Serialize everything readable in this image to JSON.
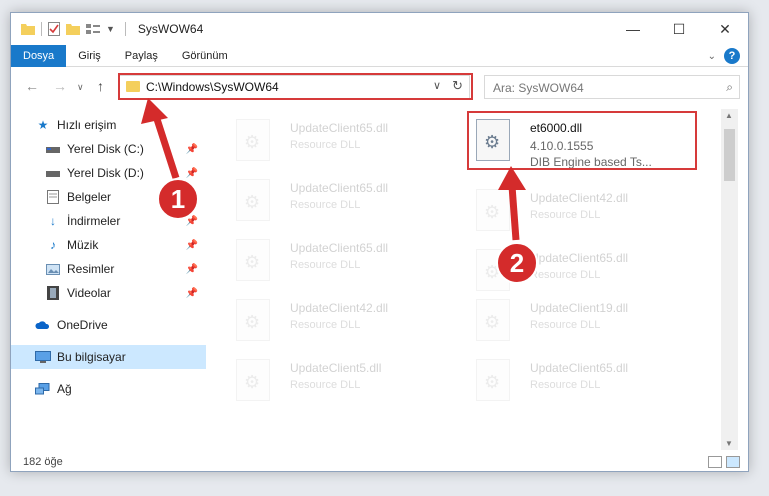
{
  "window": {
    "title": "SysWOW64"
  },
  "ribbon": {
    "tabs": [
      "Dosya",
      "Giriş",
      "Paylaş",
      "Görünüm"
    ]
  },
  "address": {
    "path": "C:\\Windows\\SysWOW64"
  },
  "search": {
    "placeholder": "Ara: SysWOW64"
  },
  "sidebar": {
    "items": [
      {
        "label": "Hızlı erişim",
        "icon": "star-icon"
      },
      {
        "label": "Yerel Disk (C:)",
        "icon": "drive-icon",
        "pinned": true
      },
      {
        "label": "Yerel Disk (D:)",
        "icon": "drive-icon",
        "pinned": true
      },
      {
        "label": "Belgeler",
        "icon": "document-icon",
        "pinned": true
      },
      {
        "label": "İndirmeler",
        "icon": "download-icon",
        "pinned": true
      },
      {
        "label": "Müzik",
        "icon": "music-icon",
        "pinned": true
      },
      {
        "label": "Resimler",
        "icon": "pictures-icon",
        "pinned": true
      },
      {
        "label": "Videolar",
        "icon": "video-icon",
        "pinned": true
      },
      {
        "label": "OneDrive",
        "icon": "cloud-icon"
      },
      {
        "label": "Bu bilgisayar",
        "icon": "computer-icon"
      },
      {
        "label": "Ağ",
        "icon": "network-icon"
      }
    ]
  },
  "files": {
    "highlighted": {
      "name": "et6000.dll",
      "version": "4.10.0.1555",
      "description": "DIB Engine based Ts..."
    },
    "faded": [
      {
        "name": "UpdateClient65.dll",
        "description": "Resource DLL"
      },
      {
        "name": "UpdateClient65.dll",
        "description": "Resource DLL"
      },
      {
        "name": "UpdateClient42.dll",
        "description": "Resource DLL"
      },
      {
        "name": "UpdateClient65.dll",
        "description": "Resource DLL"
      },
      {
        "name": "UpdateClient65.dll",
        "description": "Resource DLL"
      },
      {
        "name": "UpdateClient42.dll",
        "description": "Resource DLL"
      },
      {
        "name": "UpdateClient19.dll",
        "description": "Resource DLL"
      },
      {
        "name": "UpdateClient5.dll",
        "description": "Resource DLL"
      },
      {
        "name": "UpdateClient65.dll",
        "description": "Resource DLL"
      }
    ]
  },
  "status": {
    "count": "182 öğe"
  },
  "callouts": {
    "one": "1",
    "two": "2"
  },
  "colors": {
    "accent": "#1979ca",
    "highlight": "#d63a3a",
    "selected": "#cce8ff"
  }
}
